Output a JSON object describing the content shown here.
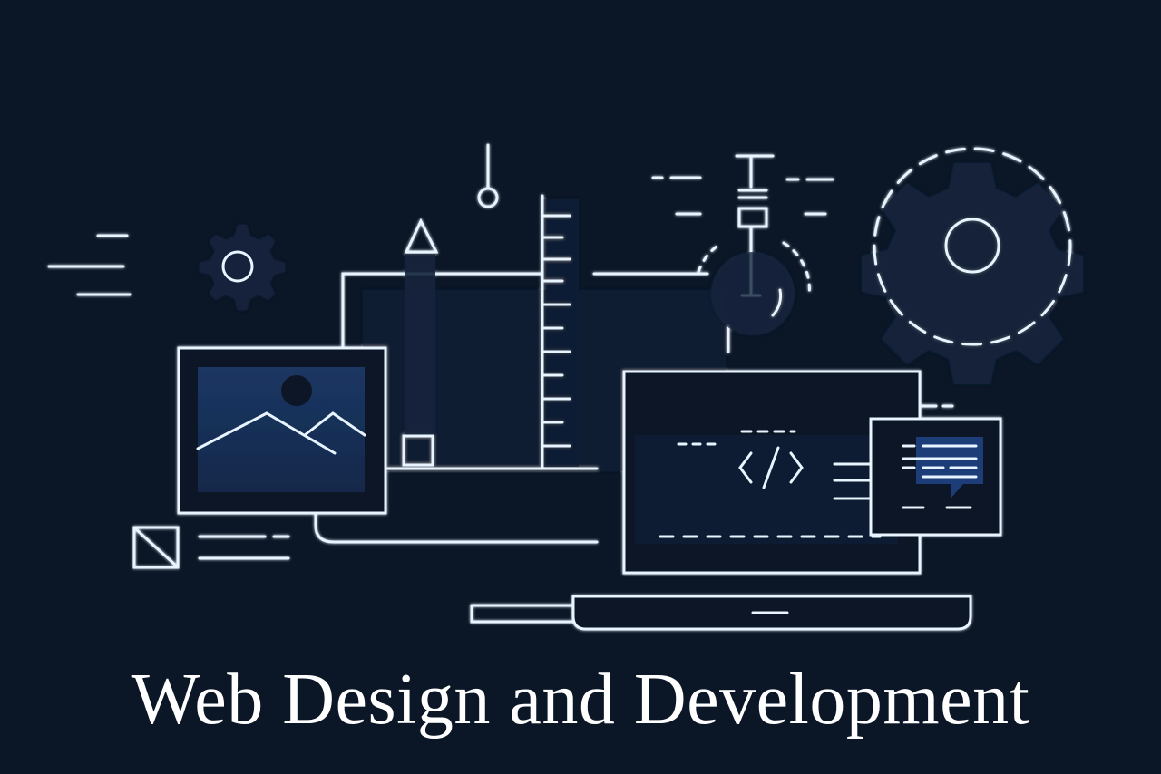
{
  "title": "Web Design and Development",
  "colors": {
    "background": "#0b1626",
    "line": "#e8f4ff",
    "glow": "#7fd0ff",
    "panel_fill": "#142a4a",
    "panel_fill_dark": "#0f1e34",
    "title_text": "#ffffff"
  },
  "icons": [
    "gear-icon",
    "dashed-gear-icon",
    "image-frame-icon",
    "pencil-icon",
    "ruler-icon",
    "pendulum-icon",
    "crop-icon",
    "code-brackets-icon",
    "chat-bubble-icon",
    "laptop-icon"
  ],
  "code_glyph": "</>"
}
